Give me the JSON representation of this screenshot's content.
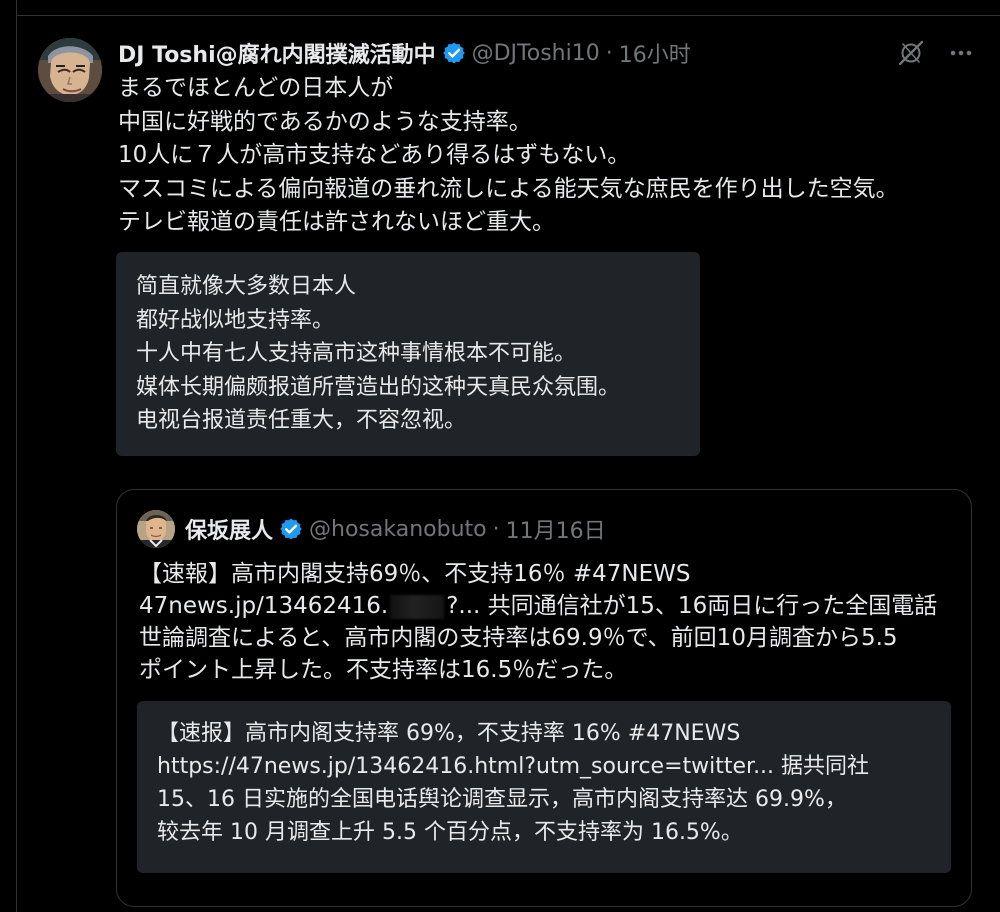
{
  "post": {
    "author": {
      "display_name": "DJ Toshi@腐れ内閣撲滅活動中",
      "handle": "@DJToshi10",
      "time": "16小时",
      "separator": "·"
    },
    "text_lines": [
      "まるでほとんどの日本人が",
      "中国に好戦的であるかのような支持率。",
      "10人に７人が高市支持などあり得るはずもない。",
      "マスコミによる偏向報道の垂れ流しによる能天気な庶民を作り出した空気。",
      "テレビ報道の責任は許されないほど重大。"
    ],
    "translation_lines": [
      "简直就像大多数日本人",
      "都好战似地支持率。",
      "十人中有七人支持高市这种事情根本不可能。",
      "媒体长期偏颇报道所营造出的这种天真民众氛围。",
      "电视台报道责任重大，不容忽视。"
    ],
    "icons": {
      "verified": "verified-badge-icon",
      "grok": "grok-icon",
      "more": "more-icon"
    }
  },
  "quoted_post": {
    "author": {
      "display_name": "保坂展人",
      "handle": "@hosakanobuto",
      "time": "11月16日",
      "separator": "·"
    },
    "text_lines": {
      "line1": "【速報】高市内閣支持69％、不支持16％ #47NEWS",
      "line2_prefix": "47news.jp/13462416.",
      "line2_suffix": "?... 共同通信社が15、16両日に行った全国電話",
      "line3": "世論調査によると、高市内閣の支持率は69.9％で、前回10月調査から5.5",
      "line4": "ポイント上昇した。不支持率は16.5％だった。"
    },
    "translation_lines": [
      "【速报】高市内阁支持率 69%，不支持率 16% #47NEWS",
      "https://47news.jp/13462416.html?utm_source=twitter... 据共同社",
      "15、16 日实施的全国电话舆论调查显示，高市内阁支持率达 69.9%，",
      "较去年 10 月调查上升 5.5 个百分点，不支持率为 16.5%。"
    ]
  },
  "colors": {
    "background": "#000000",
    "text": "#e7e9ea",
    "muted": "#71767b",
    "border": "#2f3336",
    "translation_bg": "#202327",
    "verified": "#1d9bf0"
  }
}
